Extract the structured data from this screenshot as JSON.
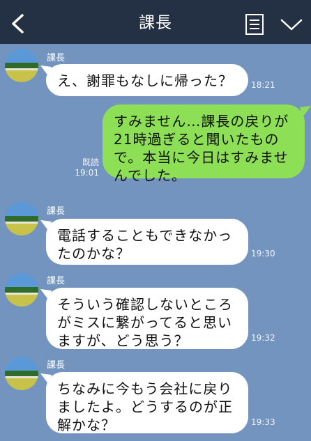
{
  "header": {
    "title": "課長"
  },
  "messages": [
    {
      "sender": "課長",
      "text": "え、謝罪もなしに帰った？",
      "time": "18:21"
    },
    {
      "sender": "me",
      "text": "すみません…課長の戻りが\n21時過ぎると聞いたもの\nで。本当に今日はすみませ\nんでした。",
      "read": "既読",
      "time": "19:01"
    },
    {
      "sender": "課長",
      "text": "電話することもできなかっ\nたのかな？",
      "time": "19:30"
    },
    {
      "sender": "課長",
      "text": "そういう確認しないところ\nがミスに繋がってると思い\nますが、どう思う？",
      "time": "19:32"
    },
    {
      "sender": "課長",
      "text": "ちなみに今もう会社に戻り\nましたよ。どうするのが正\n解かな？",
      "time": "19:33"
    }
  ],
  "colors": {
    "header": "#243044",
    "background": "#7494c0",
    "my_bubble": "#8de055"
  },
  "icons": {
    "back": "chevron-left-icon",
    "memo": "notes-icon",
    "menu": "chevron-down-icon"
  }
}
